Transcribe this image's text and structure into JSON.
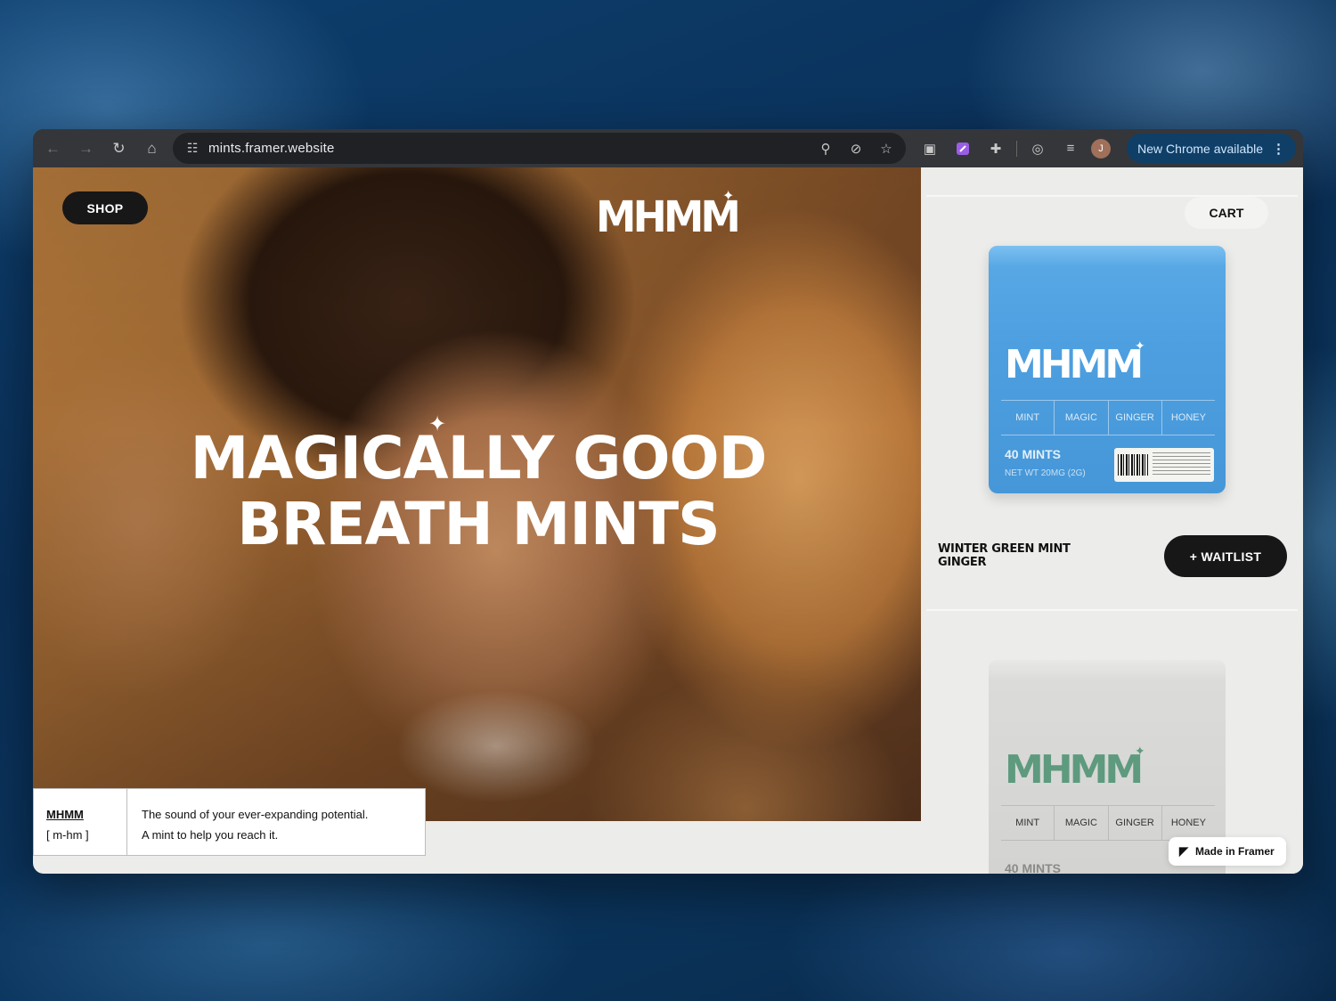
{
  "browser": {
    "url": "mints.framer.website",
    "update_label": "New Chrome available",
    "profile_initial": "J",
    "icons": {
      "back": "arrow-left-icon",
      "forward": "arrow-right-icon",
      "reload": "reload-icon",
      "home": "home-icon",
      "site_info": "tune-icon",
      "zoom": "zoom-icon",
      "eye_off": "eye-off-icon",
      "bookmark": "star-icon",
      "camera": "camera-icon",
      "extension_purple": "extension-icon",
      "puzzle": "puzzle-icon",
      "performance": "gauge-icon",
      "reading_list": "reading-list-icon",
      "more": "more-vertical-icon"
    }
  },
  "hero": {
    "shop_label": "SHOP",
    "logo": "MHMM",
    "headline_line1": "MAGICALLY GOOD",
    "headline_line2": "BREATH MINTS"
  },
  "info": {
    "brand": "MHMM",
    "pronunciation": "[ m-hm ]",
    "tagline_line1": "The sound of your ever-expanding potential.",
    "tagline_line2": "A mint to help you reach it."
  },
  "side": {
    "cart_label": "CART",
    "product1": {
      "tin_logo": "MHMM",
      "flavors": [
        "MINT",
        "MAGIC",
        "GINGER",
        "HONEY"
      ],
      "count": "40 MINTS",
      "net_weight": "NET WT 20MG (2G)",
      "name_line1": "WINTER GREEN MINT",
      "name_line2": "GINGER",
      "waitlist_label": "+ WAITLIST",
      "color": "#4d9fe0"
    },
    "product2": {
      "tin_logo": "MHMM",
      "flavors": [
        "MINT",
        "MAGIC",
        "GINGER",
        "HONEY"
      ],
      "count": "40 MINTS",
      "color": "#5e9a7e"
    },
    "framer_badge": "Made in Framer"
  }
}
